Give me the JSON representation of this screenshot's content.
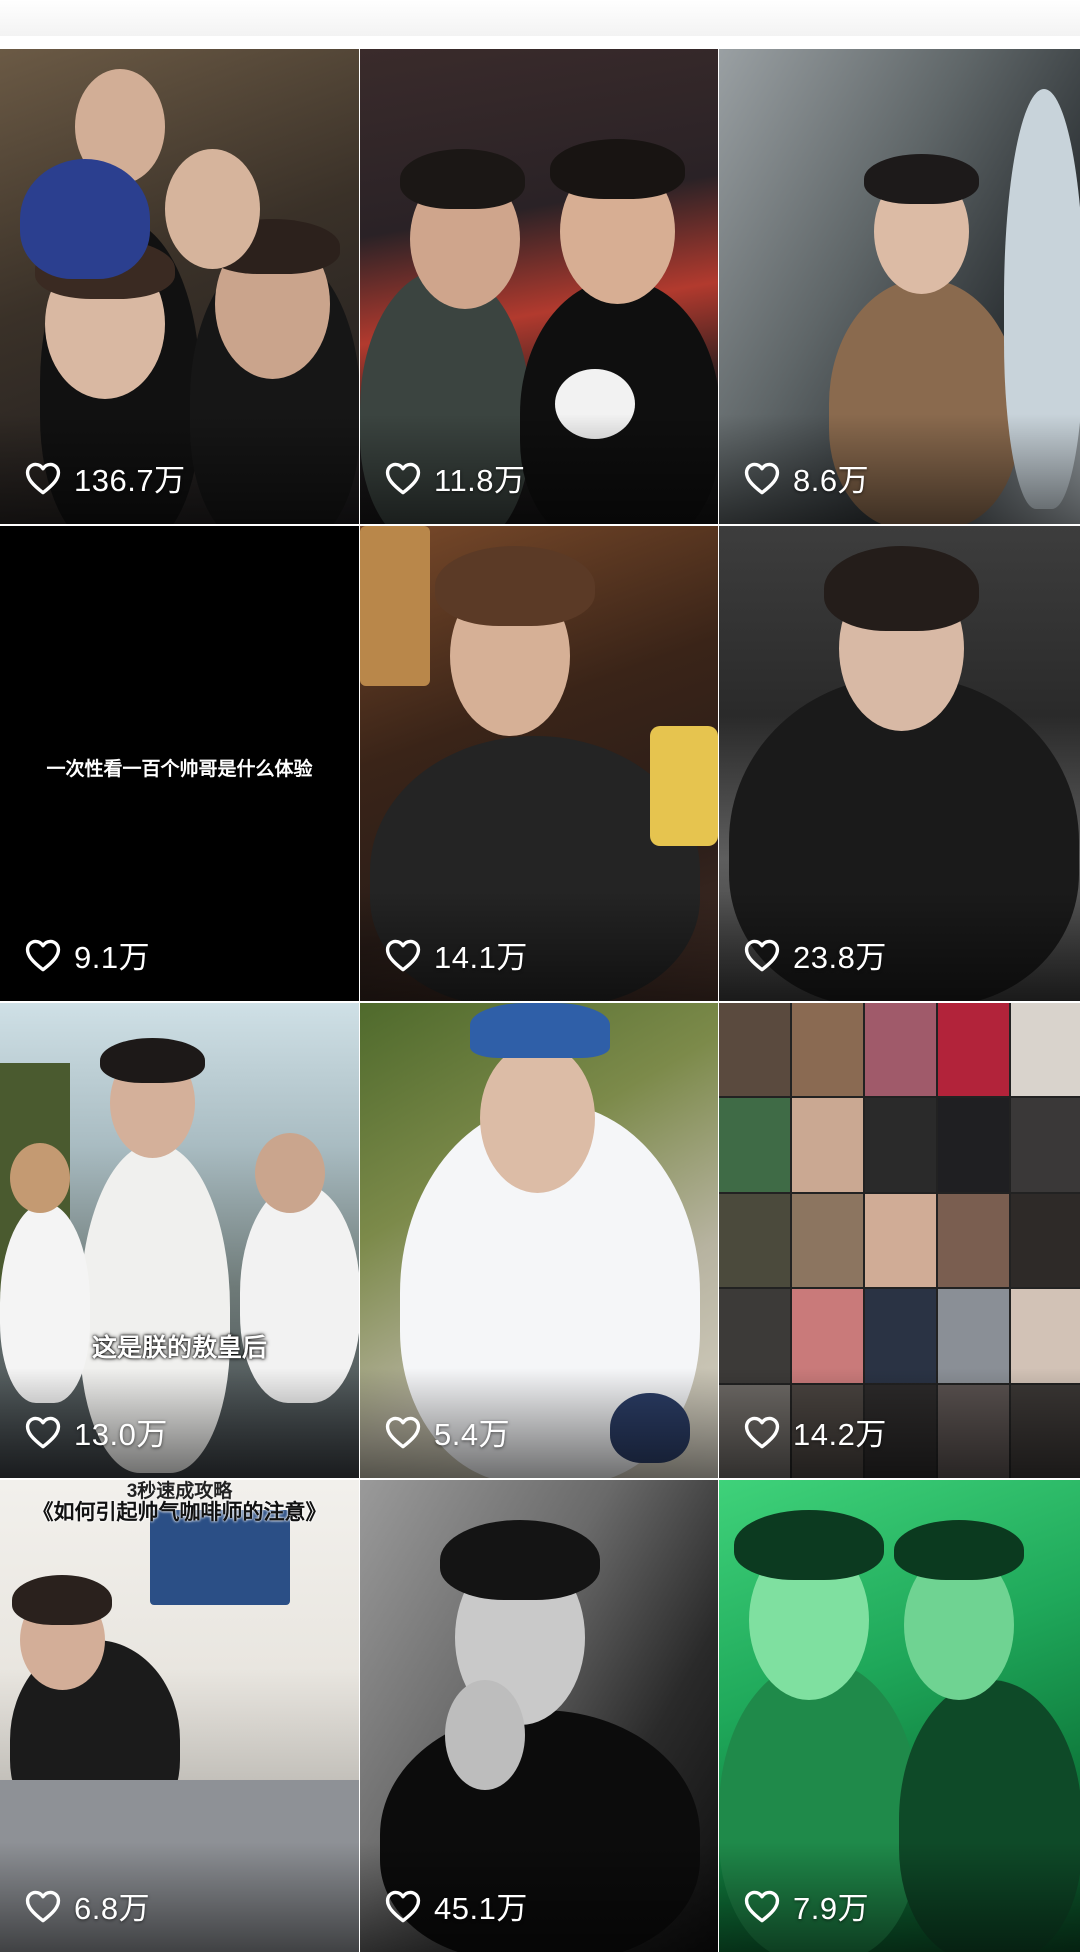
{
  "feed": {
    "items": [
      {
        "likes": "136.7万"
      },
      {
        "likes": "11.8万"
      },
      {
        "likes": "8.6万"
      },
      {
        "likes": "9.1万",
        "caption": "一次性看一百个帅哥是什么体验"
      },
      {
        "likes": "14.1万"
      },
      {
        "likes": "23.8万"
      },
      {
        "likes": "13.0万",
        "caption": "这是朕的敖皇后"
      },
      {
        "likes": "5.4万"
      },
      {
        "likes": "14.2万"
      },
      {
        "likes": "6.8万",
        "caption_top": "3秒速成攻略",
        "caption": "《如何引起帅气咖啡师的注意》"
      },
      {
        "likes": "45.1万"
      },
      {
        "likes": "7.9万"
      }
    ]
  },
  "icons": {
    "like": "heart-outline-icon"
  },
  "colors": {
    "like_text": "#ffffff",
    "background": "#ffffff"
  }
}
